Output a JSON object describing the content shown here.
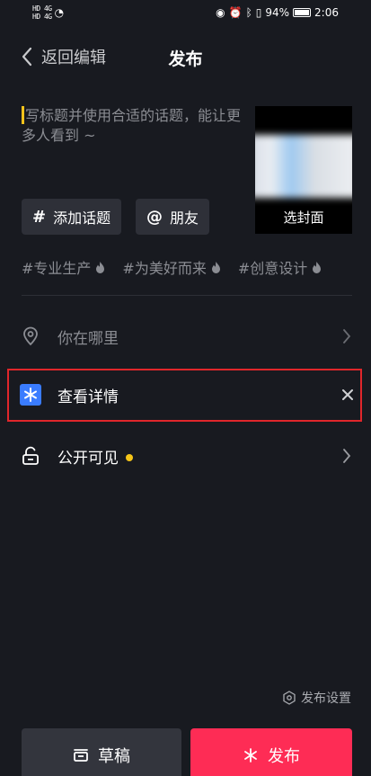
{
  "status_bar": {
    "left_indicators": [
      "HD 4G",
      "HD 4G"
    ],
    "battery": "94%",
    "time": "2:06"
  },
  "header": {
    "back_label": "返回编辑",
    "title": "发布"
  },
  "caption": {
    "placeholder": "写标题并使用合适的话题，能让更多人看到 ~"
  },
  "cover": {
    "label": "选封面"
  },
  "chips": [
    {
      "symbol": "#",
      "label": "添加话题"
    },
    {
      "symbol": "@",
      "label": "朋友"
    }
  ],
  "hashtags": [
    "#专业生产",
    "#为美好而来",
    "#创意设计"
  ],
  "rows": {
    "location": "你在哪里",
    "details": "查看详情",
    "visibility": "公开可见"
  },
  "publish_settings": "发布设置",
  "buttons": {
    "draft": "草稿",
    "publish": "发布"
  },
  "colors": {
    "background": "#181a20",
    "accent": "#fe2c55",
    "highlight_border": "#e0262b",
    "badge_dot": "#f5c518",
    "details_icon": "#3a7cff"
  }
}
